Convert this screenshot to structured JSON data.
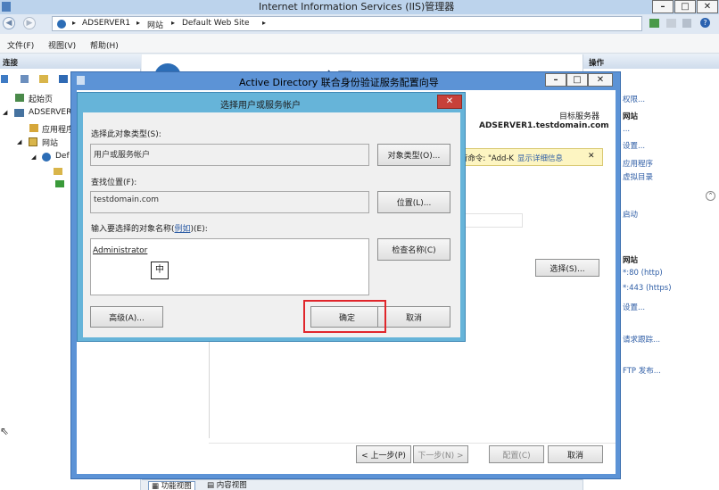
{
  "main_window": {
    "title": "Internet Information Services (IIS)管理器",
    "min": "–",
    "max": "□",
    "close": "✕"
  },
  "address": {
    "segments": [
      "ADSERVER1",
      "网站",
      "Default Web Site"
    ],
    "sep": "▸"
  },
  "menu": [
    "文件(F)",
    "视图(V)",
    "帮助(H)"
  ],
  "connections": {
    "header": "连接",
    "nodes": [
      "起始页",
      "ADSERVER",
      "应用程序",
      "网站",
      "Def"
    ]
  },
  "center": {
    "title": "Default Web Site 主页"
  },
  "actions": {
    "header": "操作",
    "items": [
      "权限...",
      "网站",
      "...",
      "设置...",
      "应用程序",
      "虚拟目录",
      "启动",
      "网站",
      "*:80 (http)",
      "*:443 (https)",
      "设置...",
      "请求跟踪...",
      "FTP 发布..."
    ]
  },
  "bottom_tabs": [
    "功能视图",
    "内容视图"
  ],
  "wizard": {
    "title": "Active Directory 联合身份验证服务配置向导",
    "target_label": "目标服务器",
    "target_value": "ADSERVER1.testdomain.com",
    "warning_text": "预先所需条件检查后结果显示: 运行命令: \"Add-K...",
    "warning_link": "显示详细信息",
    "warning_close": "✕",
    "select_button": "选择(S)...",
    "prev": "< 上一步(P)",
    "next": "下一步(N) >",
    "configure": "配置(C)",
    "cancel": "取消"
  },
  "dialog": {
    "title": "选择用户或服务帐户",
    "object_type_label": "选择此对象类型(S):",
    "object_type_value": "用户或服务帐户",
    "object_type_btn": "对象类型(O)...",
    "location_label": "查找位置(F):",
    "location_value": "testdomain.com",
    "location_btn": "位置(L)...",
    "enter_label_prefix": "输入要选择的对象名称(",
    "enter_label_link": "例如",
    "enter_label_suffix": ")(E):",
    "object_name": "Administrator",
    "check_names_btn": "检查名称(C)",
    "advanced_btn": "高级(A)...",
    "ok_btn": "确定",
    "cancel_btn": "取消",
    "ime": "中"
  }
}
